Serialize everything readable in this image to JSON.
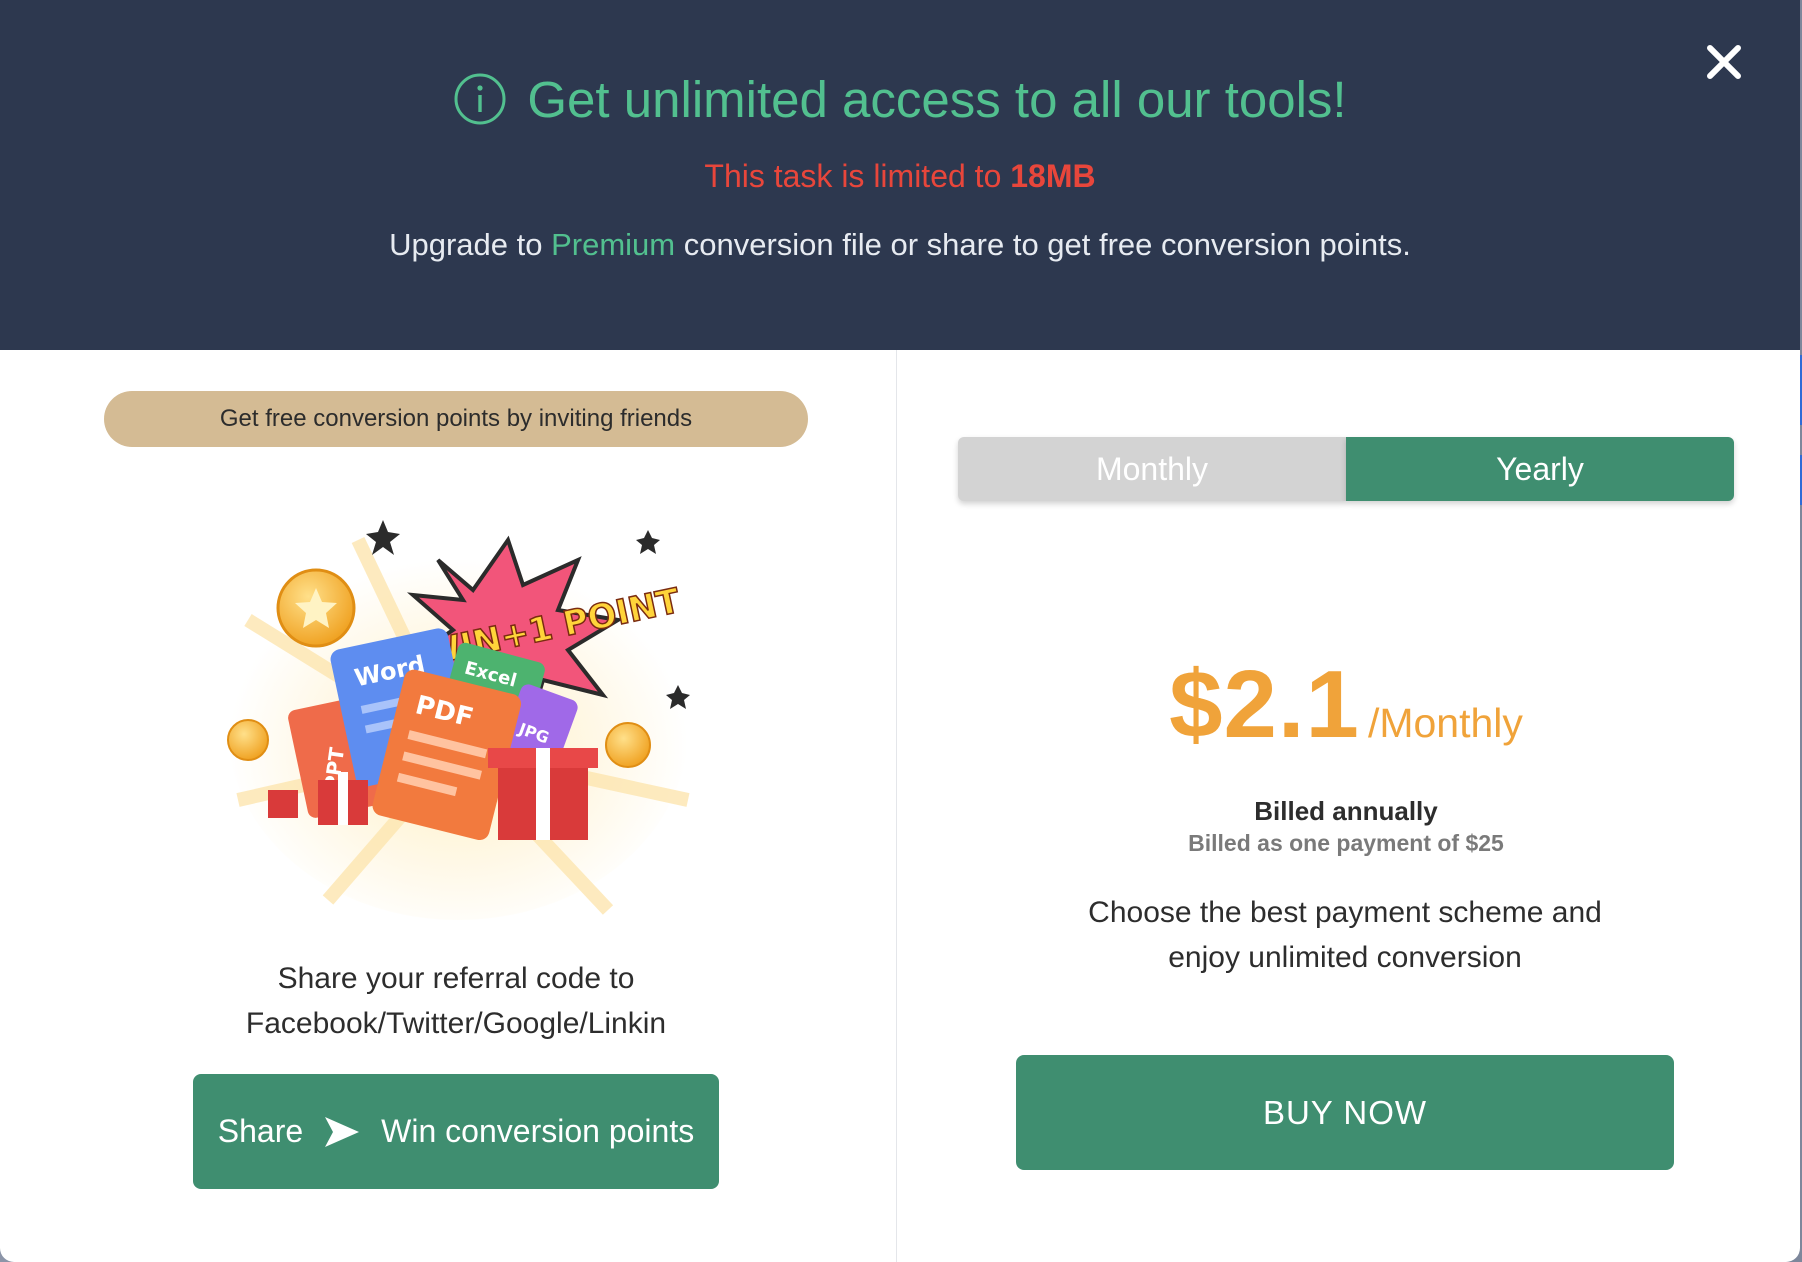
{
  "header": {
    "title": "Get unlimited access to all our tools!",
    "limit_prefix": "This task is limited to ",
    "limit_value": "18MB",
    "upgrade_prefix": "Upgrade to ",
    "upgrade_highlight": "Premium",
    "upgrade_suffix": " conversion file or share to get free conversion points.",
    "title_color": "#52c08f",
    "limit_color": "#e8463b",
    "background": "#2d384f"
  },
  "close": {
    "icon": "close-icon"
  },
  "referral": {
    "pill_label": "Get free conversion points by inviting friends",
    "promo_badge": "WIN+1 POINT",
    "promo_files": [
      "Word",
      "Excel",
      "PDF",
      "PPT",
      "JPG"
    ],
    "description_line1": "Share your referral code to",
    "description_line2": "Facebook/Twitter/Google/Linkin",
    "share_label": "Share",
    "share_action": "Win conversion points"
  },
  "pricing": {
    "tabs": [
      {
        "label": "Monthly",
        "active": false
      },
      {
        "label": "Yearly",
        "active": true
      }
    ],
    "price": "$2.1",
    "price_unit": "/Monthly",
    "billed_title": "Billed annually",
    "billed_detail": "Billed as one payment of $25",
    "description_line1": "Choose the best payment scheme and",
    "description_line2": "enjoy unlimited conversion",
    "buy_label": "BUY NOW",
    "accent_color": "#3f8e70",
    "price_color": "#f0a33a"
  }
}
